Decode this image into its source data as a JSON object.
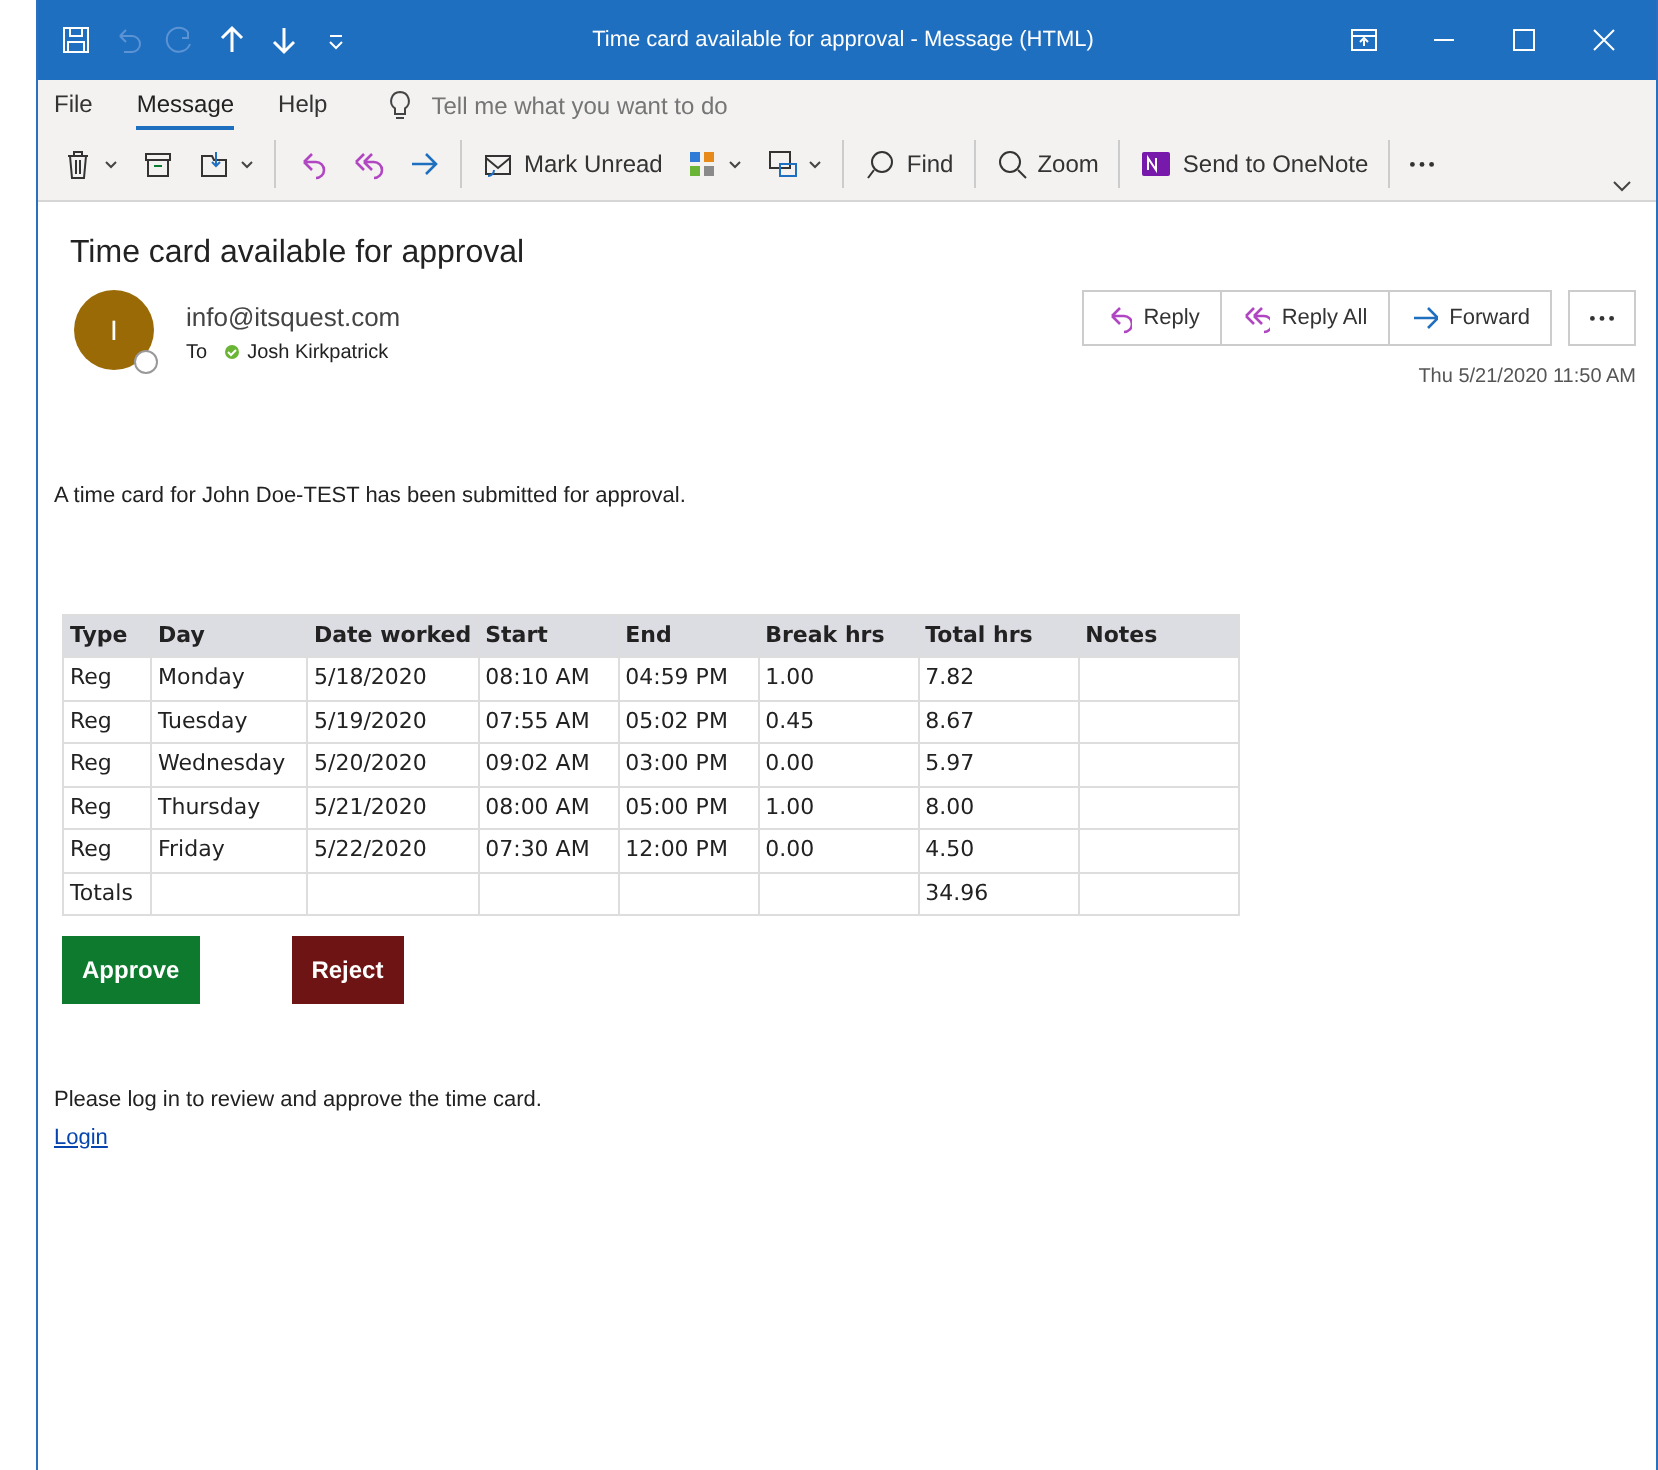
{
  "window": {
    "title": "Time card available for approval  -  Message (HTML)"
  },
  "quick_access": [
    {
      "disabled": false
    },
    {
      "disabled": true
    },
    {
      "disabled": true
    },
    {
      "disabled": false
    },
    {
      "disabled": false
    },
    {
      "disabled": false
    }
  ],
  "ribbon_tabs": [
    {
      "label": "File",
      "selected": false
    },
    {
      "label": "Message",
      "selected": true
    },
    {
      "label": "Help",
      "selected": false
    }
  ],
  "tell_me": {
    "placeholder": "Tell me what you want to do"
  },
  "toolbar": [
    {
      "kind": "delete",
      "dropdown": true
    },
    {
      "kind": "archive",
      "dropdown": false
    },
    {
      "kind": "move",
      "dropdown": true
    },
    {
      "kind": "reply",
      "dropdown": false
    },
    {
      "kind": "replyall",
      "dropdown": false
    },
    {
      "kind": "forward",
      "dropdown": false
    },
    {
      "kind": "unread",
      "label": "Mark Unread",
      "dropdown": false
    },
    {
      "kind": "categorize",
      "dropdown": true
    },
    {
      "kind": "followup",
      "dropdown": true
    },
    {
      "kind": "find",
      "label": "Find",
      "dropdown": false
    },
    {
      "kind": "zoom",
      "label": "Zoom",
      "dropdown": false
    },
    {
      "kind": "onenote",
      "label": "Send to OneNote",
      "dropdown": false
    },
    {
      "kind": "more",
      "dropdown": false
    }
  ],
  "message": {
    "subject": "Time card available for approval",
    "avatar_letter": "I",
    "sender": "info@itsquest.com",
    "to_label": "To",
    "recipient": "Josh Kirkpatrick",
    "date": "Thu 5/21/2020 11:50 AM",
    "actions": [
      {
        "kind": "reply",
        "label": "Reply"
      },
      {
        "kind": "replyall",
        "label": "Reply All"
      },
      {
        "kind": "forward",
        "label": "Forward"
      }
    ]
  },
  "body": {
    "intro": "A time card for John Doe-TEST has been submitted for approval.",
    "table": {
      "columns": [
        "Type",
        "Day",
        "Date worked",
        "Start",
        "End",
        "Break hrs",
        "Total hrs",
        "Notes"
      ],
      "rows": [
        [
          "Reg",
          "Monday",
          "5/18/2020",
          "08:10 AM",
          "04:59 PM",
          "1.00",
          "7.82",
          ""
        ],
        [
          "Reg",
          "Tuesday",
          "5/19/2020",
          "07:55 AM",
          "05:02 PM",
          "0.45",
          "8.67",
          ""
        ],
        [
          "Reg",
          "Wednesday",
          "5/20/2020",
          "09:02 AM",
          "03:00 PM",
          "0.00",
          "5.97",
          ""
        ],
        [
          "Reg",
          "Thursday",
          "5/21/2020",
          "08:00 AM",
          "05:00 PM",
          "1.00",
          "8.00",
          ""
        ],
        [
          "Reg",
          "Friday",
          "5/22/2020",
          "07:30 AM",
          "12:00 PM",
          "0.00",
          "4.50",
          ""
        ],
        [
          "Totals",
          "",
          "",
          "",
          "",
          "",
          "34.96",
          ""
        ]
      ]
    },
    "buttons": [
      {
        "kind": "approve",
        "label": "Approve"
      },
      {
        "kind": "reject",
        "label": "Reject"
      }
    ],
    "closing": "Please log in to review and approve the time card.",
    "link": "Login"
  }
}
